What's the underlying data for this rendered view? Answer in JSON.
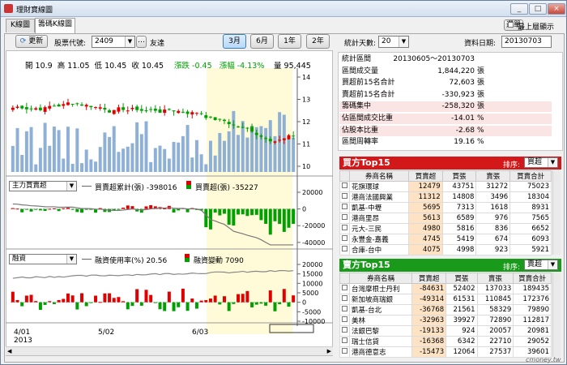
{
  "window": {
    "title": "理財寶線圖",
    "menu_button": "選單",
    "topmost_label": "最上層顯示",
    "min": "_",
    "max": "□",
    "close": "×"
  },
  "tabs": [
    "K線圖",
    "籌碼K線圖"
  ],
  "toolbar": {
    "refresh_label": "更新",
    "stock_code_label": "股票代號:",
    "stock_code": "2409",
    "stock_name": "友達",
    "more": "…",
    "ranges": [
      "3月",
      "6月",
      "1年",
      "2年"
    ],
    "active_range": "3月",
    "stat_days_label": "統計天數:",
    "stat_days": "20",
    "data_date_label": "資料日期:",
    "data_date": "20130703"
  },
  "price_header": {
    "open_label": "開",
    "open": "10.9",
    "high_label": "高",
    "high": "11.05",
    "low_label": "低",
    "low": "10.45",
    "close_label": "收",
    "close": "10.45",
    "change_label": "漲跌",
    "change": "-0.45",
    "pct_label": "漲幅",
    "pct": "-4.13%",
    "vol_label": "量",
    "vol": "95,445"
  },
  "price_axis": [
    "14",
    "13",
    "12",
    "11",
    "10"
  ],
  "inst_panel": {
    "select": "主力買賣超",
    "cum_label": "買賣超累計(張)",
    "cum_value": "-398016",
    "net_label": "買賣超(張)",
    "net_value": "-35227",
    "axis": [
      "20000",
      "0",
      "-20000",
      "-40000"
    ]
  },
  "margin_panel": {
    "select": "融資",
    "rate_label": "融資使用率(%)",
    "rate_value": "20.56",
    "chg_label": "融資變動",
    "chg_value": "7090",
    "axis": [
      "20000",
      "15000",
      "10000",
      "5000",
      "0",
      "-5000",
      "-10000"
    ]
  },
  "x_axis": {
    "labels": [
      "4/01",
      "5/02",
      "6/03"
    ],
    "year": "2013"
  },
  "stats": [
    {
      "k": "統計區間",
      "v": "20130605～20130703",
      "u": ""
    },
    {
      "k": "區間成交量",
      "v": "1,844,220",
      "u": "張"
    },
    {
      "k": "買超前15名合計",
      "v": "72,603",
      "u": "張"
    },
    {
      "k": "賣超前15名合計",
      "v": "-330,923",
      "u": "張"
    },
    {
      "k": "籌碼集中",
      "v": "-258,320",
      "u": "張"
    },
    {
      "k": "佔區間成交比重",
      "v": "-14.01",
      "u": "%"
    },
    {
      "k": "佔股本比重",
      "v": "-2.68",
      "u": "%"
    },
    {
      "k": "區間周轉率",
      "v": "19.16",
      "u": "%"
    }
  ],
  "buy_top": {
    "title": "買方Top15",
    "sort_label": "排序:",
    "sort_value": "買超",
    "headers": [
      "券商名稱",
      "買賣超",
      "買張",
      "賣張",
      "買賣合計"
    ],
    "rows": [
      [
        "花旗環球",
        "12479",
        "43751",
        "31272",
        "75023"
      ],
      [
        "港商法國興業",
        "11312",
        "14808",
        "3496",
        "18304"
      ],
      [
        "凱基-中壢",
        "5695",
        "7313",
        "1618",
        "8931"
      ],
      [
        "港商里昂",
        "5613",
        "6589",
        "976",
        "7565"
      ],
      [
        "元大-三民",
        "4980",
        "5816",
        "836",
        "6652"
      ],
      [
        "永豐金-嘉義",
        "4745",
        "5419",
        "674",
        "6093"
      ],
      [
        "合庫-台中",
        "4075",
        "4998",
        "923",
        "5921"
      ]
    ]
  },
  "sell_top": {
    "title": "賣方Top15",
    "sort_label": "排序:",
    "sort_value": "賣超",
    "headers": [
      "券商名稱",
      "買賣超",
      "買張",
      "賣張",
      "買賣合計"
    ],
    "rows": [
      [
        "台灣摩根士丹利",
        "-84631",
        "52402",
        "137033",
        "189435"
      ],
      [
        "新加坡商瑞銀",
        "-49314",
        "61531",
        "110845",
        "172376"
      ],
      [
        "凱基-台北",
        "-36768",
        "21561",
        "58329",
        "79890"
      ],
      [
        "美林",
        "-32963",
        "39927",
        "72890",
        "112817"
      ],
      [
        "法銀巴黎",
        "-19133",
        "924",
        "20057",
        "20981"
      ],
      [
        "瑞士信貸",
        "-16368",
        "6342",
        "22710",
        "29052"
      ],
      [
        "港商德意志",
        "-15473",
        "12064",
        "27537",
        "39601"
      ]
    ]
  },
  "watermark": "cmoney.tw",
  "colors": {
    "up": "#e00000",
    "down": "#00a000",
    "buy_header": "#d21818",
    "sell_header": "#1a9a1a",
    "volume": "#8fb0d6",
    "highlight": "#fffbd8"
  }
}
